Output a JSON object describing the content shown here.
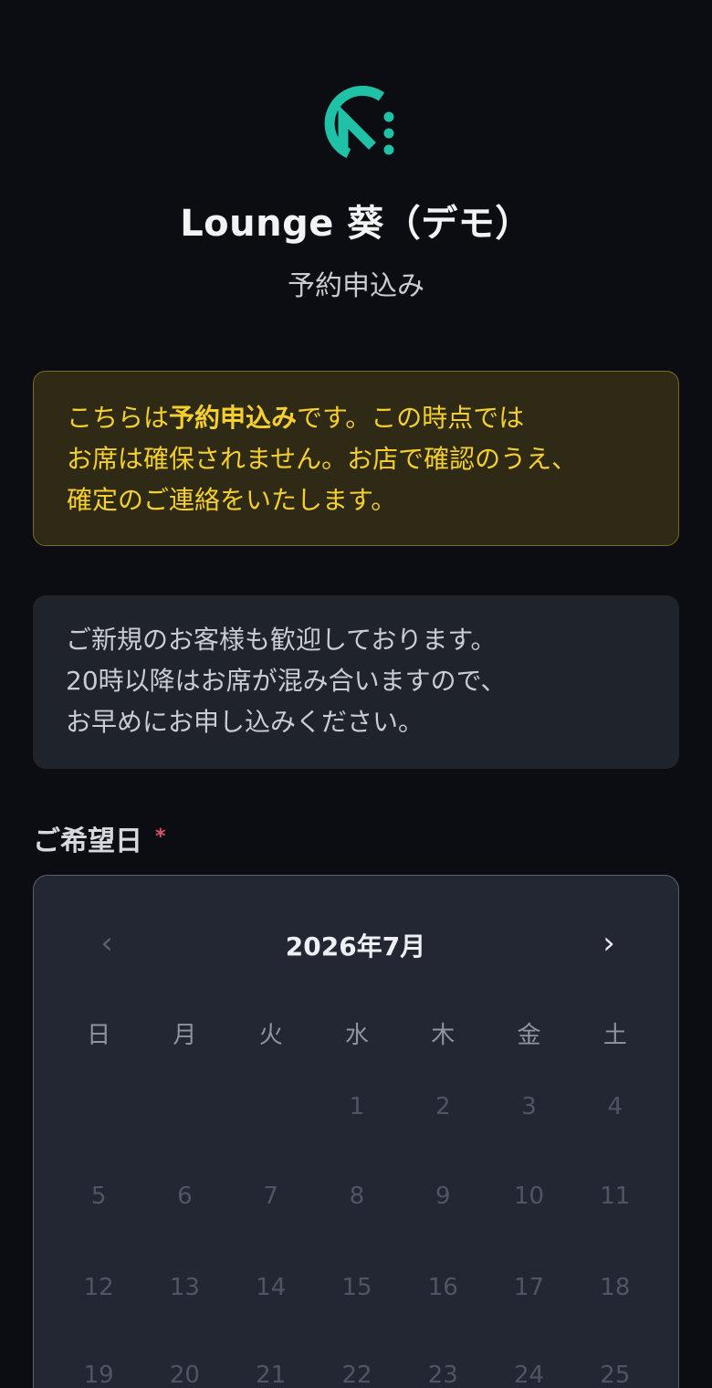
{
  "header": {
    "title": "Lounge 葵（デモ）",
    "subtitle": "予約申込み",
    "logo_icon": "store-logo-icon",
    "accent_color": "#1fc1a7"
  },
  "notice": {
    "line1_prefix": "こちらは",
    "line1_bold": "予約申込み",
    "line1_suffix": "です。この時点では",
    "line2": "お席は確保されません。お店で確認のうえ、",
    "line3": "確定のご連絡をいたします。",
    "text_color": "#f5cf2e"
  },
  "info": {
    "line1": "ご新規のお客様も歓迎しております。",
    "line2": "20時以降はお席が混み合いますので、",
    "line3": "お早めにお申し込みください。"
  },
  "date_field": {
    "label": "ご希望日",
    "required_mark": "*"
  },
  "calendar": {
    "prev_icon": "chevron-left-icon",
    "prev_glyph": "‹",
    "next_icon": "chevron-right-icon",
    "next_glyph": "›",
    "month_label": "2026年7月",
    "weekdays": [
      "日",
      "月",
      "火",
      "水",
      "木",
      "金",
      "土"
    ],
    "weeks": [
      [
        "",
        "",
        "",
        "1",
        "2",
        "3",
        "4"
      ],
      [
        "5",
        "6",
        "7",
        "8",
        "9",
        "10",
        "11"
      ],
      [
        "12",
        "13",
        "14",
        "15",
        "16",
        "17",
        "18"
      ],
      [
        "19",
        "20",
        "21",
        "22",
        "23",
        "24",
        "25"
      ]
    ]
  }
}
